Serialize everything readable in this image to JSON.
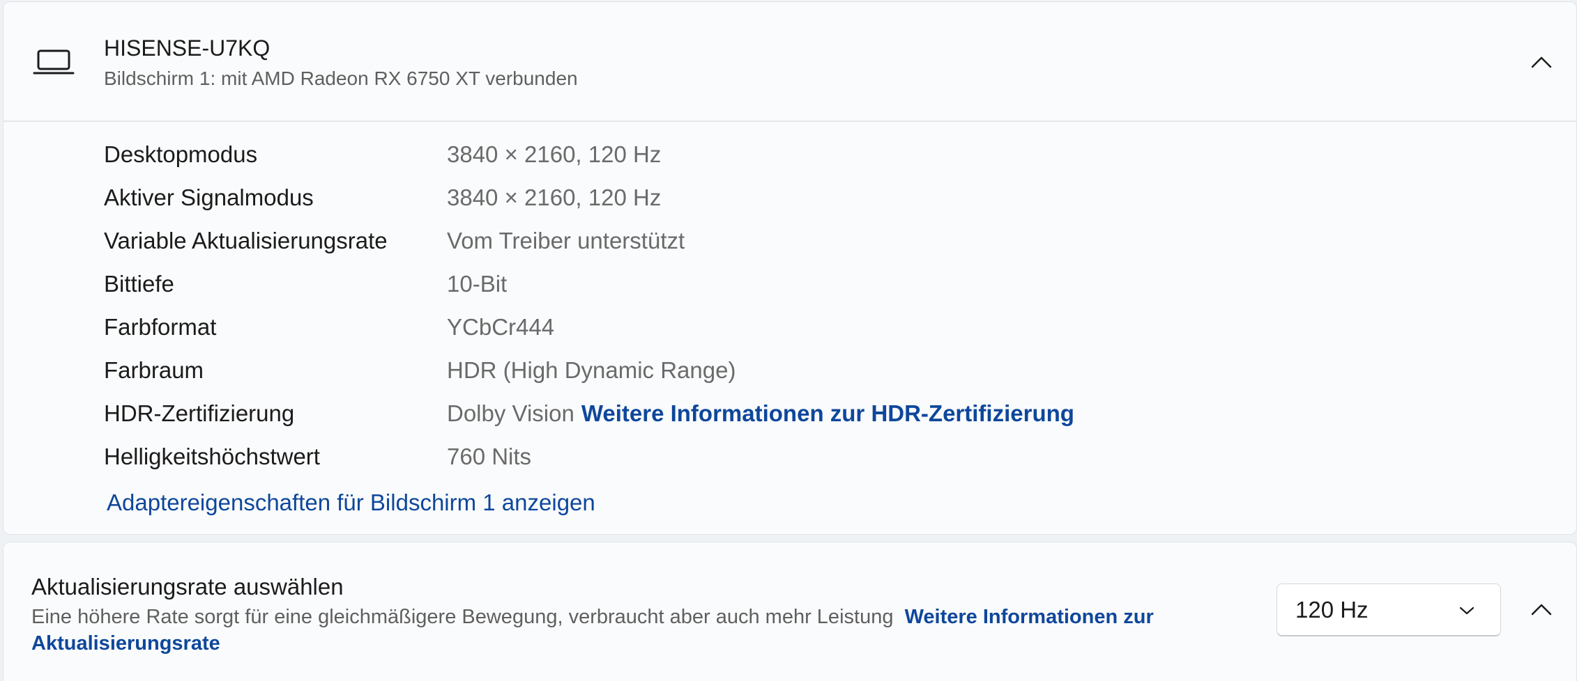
{
  "display": {
    "name": "HISENSE-U7KQ",
    "subtitle": "Bildschirm 1: mit AMD Radeon RX 6750 XT verbunden",
    "icon": "laptop-icon",
    "properties": [
      {
        "label": "Desktopmodus",
        "value": "3840 × 2160, 120 Hz"
      },
      {
        "label": "Aktiver Signalmodus",
        "value": "3840 × 2160, 120 Hz"
      },
      {
        "label": "Variable Aktualisierungsrate",
        "value": "Vom Treiber unterstützt"
      },
      {
        "label": "Bittiefe",
        "value": "10-Bit"
      },
      {
        "label": "Farbformat",
        "value": "YCbCr444"
      },
      {
        "label": "Farbraum",
        "value": "HDR (High Dynamic Range)"
      },
      {
        "label": "HDR-Zertifizierung",
        "value": "Dolby Vision",
        "link": "Weitere Informationen zur HDR-Zertifizierung"
      },
      {
        "label": "Helligkeitshöchstwert",
        "value": "760 Nits"
      }
    ],
    "adapter_link": "Adaptereigenschaften für Bildschirm 1 anzeigen"
  },
  "refresh": {
    "title": "Aktualisierungsrate auswählen",
    "description": "Eine höhere Rate sorgt für eine gleichmäßigere Bewegung, verbraucht aber auch mehr Leistung",
    "link": "Weitere Informationen zur Aktualisierungsrate",
    "selected": "120 Hz"
  },
  "colors": {
    "link": "#0e479b",
    "secondary_text": "#5f5f5f",
    "card_background": "#fafbfc"
  }
}
